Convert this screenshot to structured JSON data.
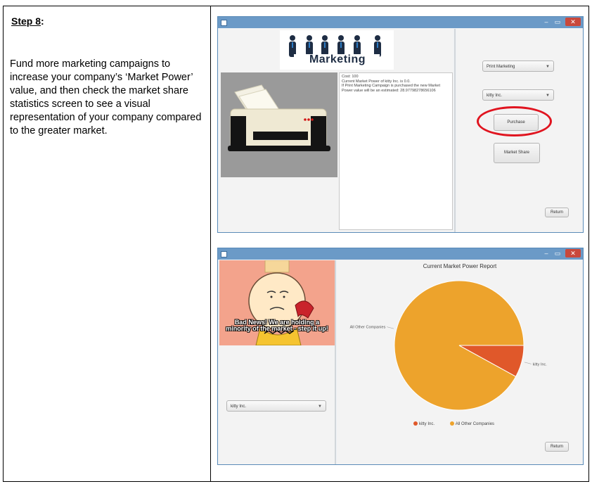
{
  "step": {
    "title_prefix": "Step 8",
    "title_suffix": ":",
    "description": "Fund more marketing campaigns to increase your company’s ‘Market Power’ value, and then check the market share statistics screen to see a visual representation of your company compared to the greater market."
  },
  "marketing_window": {
    "banner_text": "Marketing",
    "info_lines": [
      "Cost: 100",
      "Current Market Power of kitty Inc. is 0.0.",
      "If Print Marketing Campaign is purchased the new Market",
      "Power value will be an estimated: 28.97798278656106"
    ],
    "campaign_select": "Print Marketing",
    "company_select": "kitty Inc.",
    "purchase_label": "Purchase",
    "market_share_label": "Market Share",
    "return_label": "Return"
  },
  "report_window": {
    "meme_caption": "Bad News! We are holding a minority of the market - step it up!",
    "company_select": "kitty Inc.",
    "return_label": "Return"
  },
  "chart_data": {
    "type": "pie",
    "title": "Current Market Power Report",
    "categories": [
      "kitty Inc.",
      "All Other Companies"
    ],
    "values": [
      8,
      92
    ],
    "colors": [
      "#e0582a",
      "#eda32c"
    ],
    "legend_placement": "bottom"
  }
}
